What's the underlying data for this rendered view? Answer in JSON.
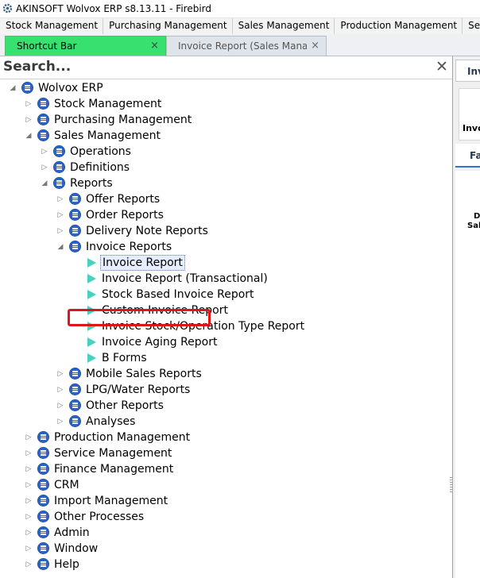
{
  "window": {
    "title": "AKINSOFT Wolvox ERP s8.13.11 - Firebird",
    "icon": "gear-icon"
  },
  "menubar": {
    "items": [
      "Stock Management",
      "Purchasing Management",
      "Sales Management",
      "Production Management",
      "Service Management"
    ]
  },
  "tabs": [
    {
      "label": "Shortcut Bar",
      "close": "×",
      "active": true,
      "color": "#38e070"
    },
    {
      "label": "Invoice Report (Sales Management)",
      "close": "×",
      "active": false
    }
  ],
  "search": {
    "placeholder": "Search...",
    "close": "✕"
  },
  "tree": {
    "root": "Wolvox ERP",
    "stock": "Stock Management",
    "purchasing": "Purchasing Management",
    "sales": "Sales Management",
    "operations": "Operations",
    "definitions": "Definitions",
    "reports": "Reports",
    "offer_reports": "Offer Reports",
    "order_reports": "Order Reports",
    "delivery_note_reports": "Delivery Note Reports",
    "invoice_reports": "Invoice Reports",
    "invoice_report": "Invoice Report",
    "invoice_report_transactional": "Invoice Report (Transactional)",
    "stock_based_invoice_report": "Stock Based Invoice Report",
    "custom_invoice_report": "Custom Invoice Report",
    "invoice_stock_operation_type_report": "Invoice Stock/Operation Type Report",
    "invoice_aging_report": "Invoice Aging Report",
    "b_forms": "B Forms",
    "mobile_sales_reports": "Mobile Sales Reports",
    "lpg_water_reports": "LPG/Water Reports",
    "other_reports": "Other Reports",
    "analyses": "Analyses",
    "production": "Production Management",
    "service": "Service Management",
    "finance": "Finance Management",
    "crm": "CRM",
    "import": "Import Management",
    "other_processes": "Other Processes",
    "admin": "Admin",
    "window": "Window",
    "help": "Help",
    "selected_item": "Invoice Report",
    "highlight_color": "#e0141b"
  },
  "right_panel": {
    "tab_label": "Inv",
    "box_label": "Invo",
    "fav_label": "Fav",
    "text1": "D",
    "text2": "Sal"
  }
}
